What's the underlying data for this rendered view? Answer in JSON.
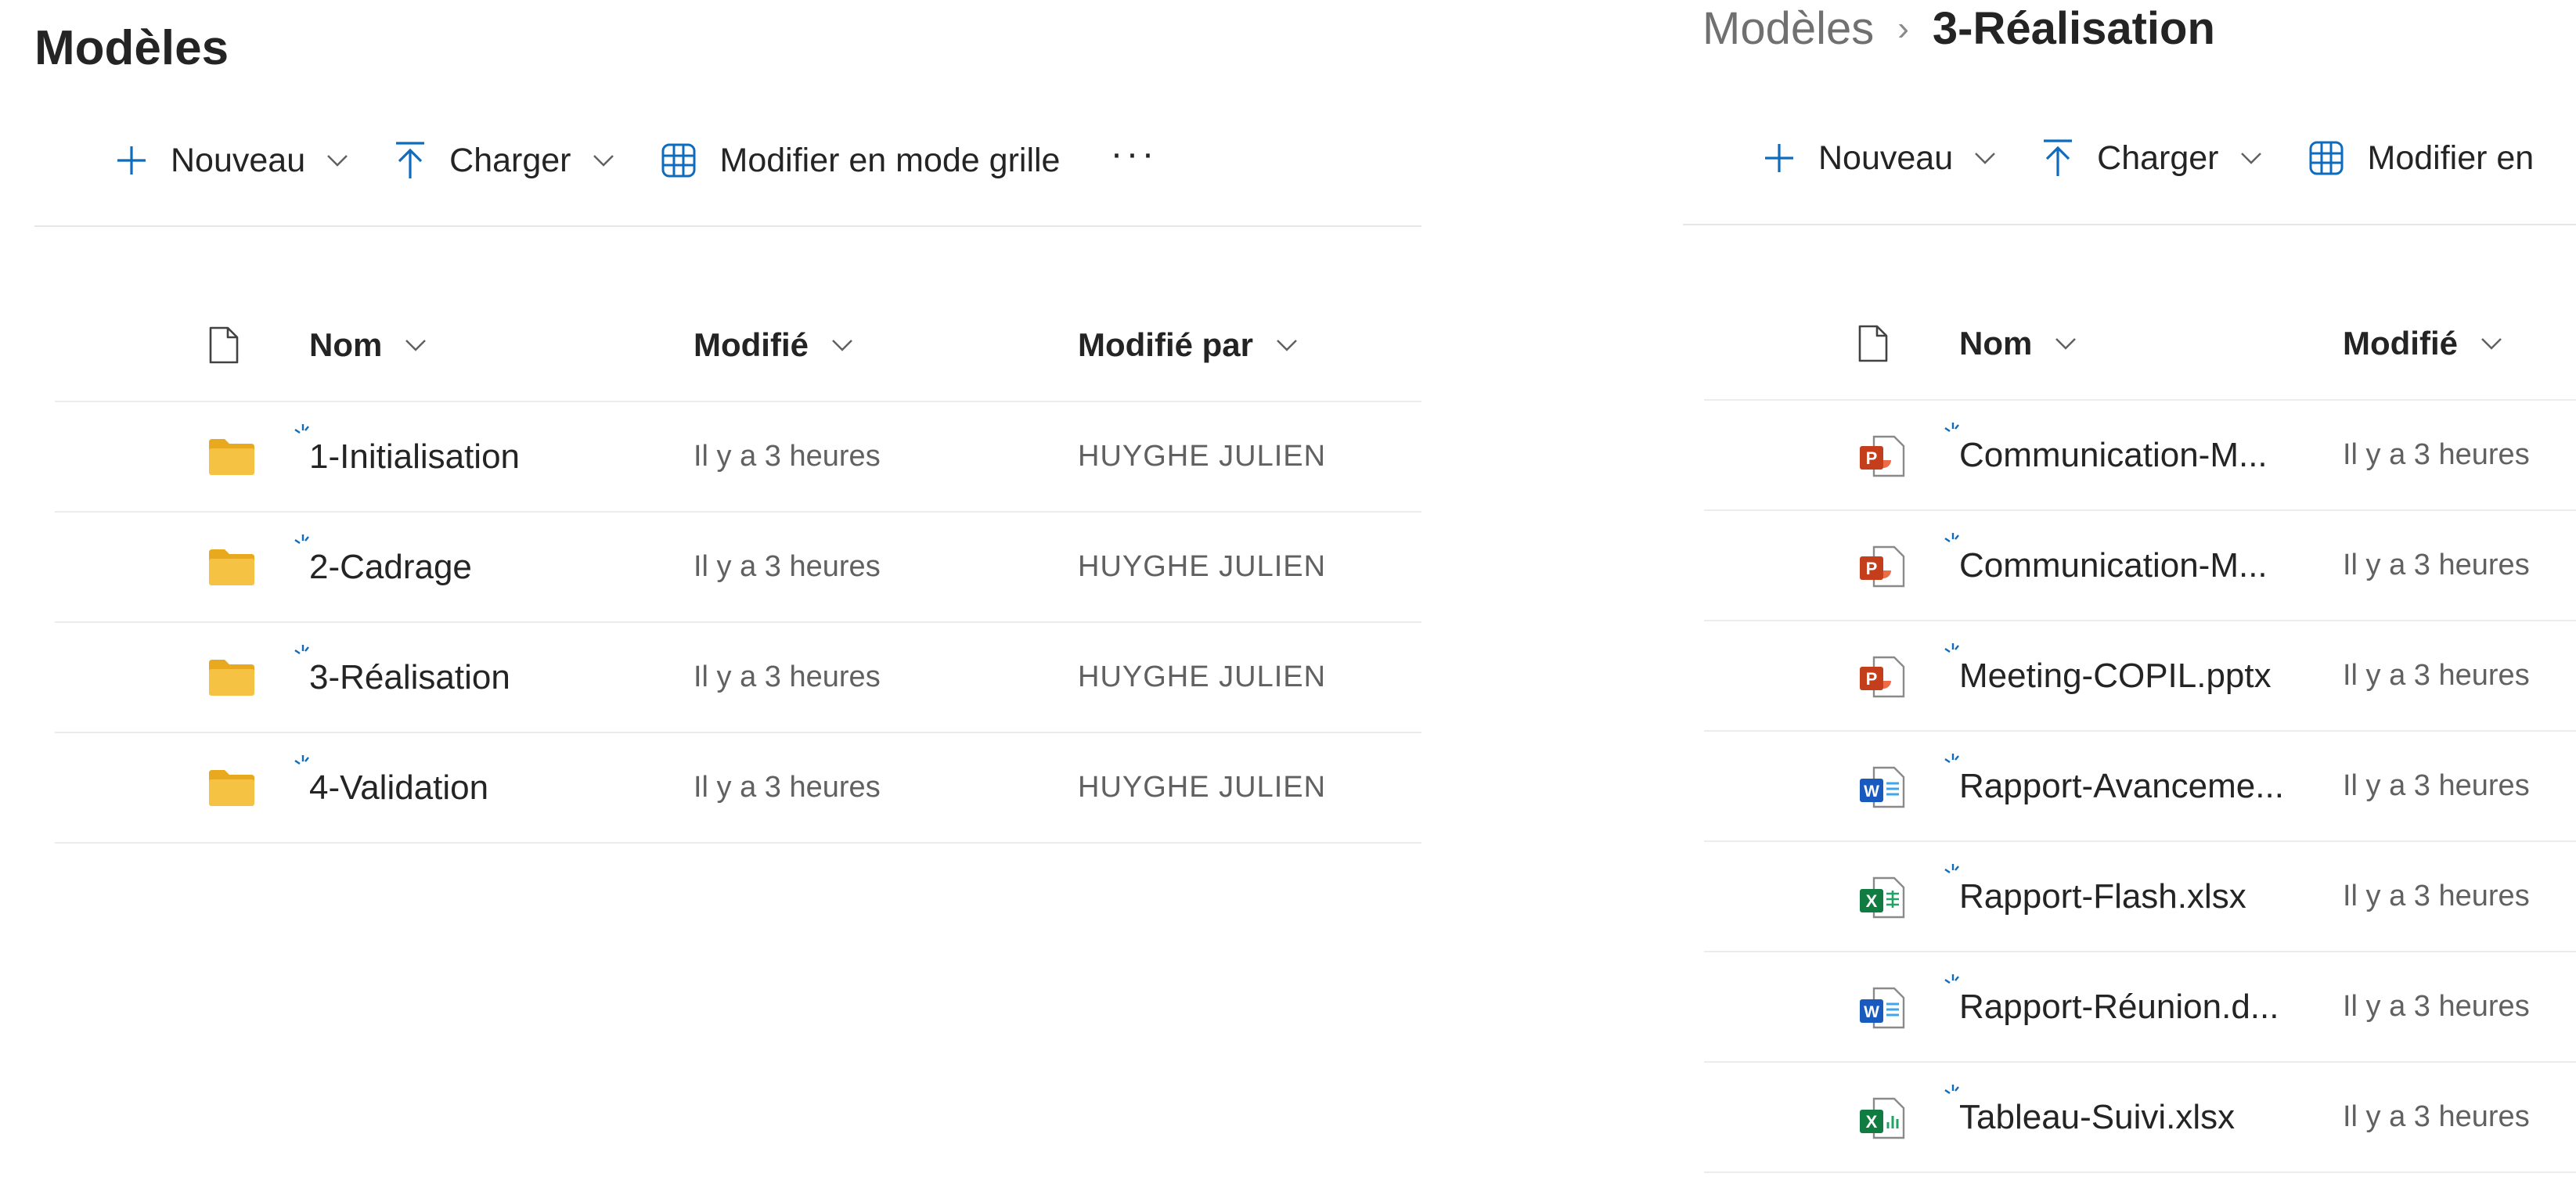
{
  "colors": {
    "accent": "#0f6cbd",
    "folder": "#f6c244",
    "folder_back": "#e8a91f",
    "ppt": "#c43e1c",
    "word": "#185abd",
    "excel": "#107c41",
    "text": "#242424",
    "muted": "#616161"
  },
  "left": {
    "title": "Modèles",
    "toolbar": {
      "new_label": "Nouveau",
      "upload_label": "Charger",
      "grid_label": "Modifier en mode grille",
      "more_label": "···"
    },
    "columns": {
      "name": "Nom",
      "modified": "Modifié",
      "modified_by": "Modifié par"
    },
    "rows": [
      {
        "icon": "folder-icon",
        "name": "1-Initialisation",
        "modified": "Il y a 3 heures",
        "modified_by": "HUYGHE JULIEN"
      },
      {
        "icon": "folder-icon",
        "name": "2-Cadrage",
        "modified": "Il y a 3 heures",
        "modified_by": "HUYGHE JULIEN"
      },
      {
        "icon": "folder-icon",
        "name": "3-Réalisation",
        "modified": "Il y a 3 heures",
        "modified_by": "HUYGHE JULIEN"
      },
      {
        "icon": "folder-icon",
        "name": "4-Validation",
        "modified": "Il y a 3 heures",
        "modified_by": "HUYGHE JULIEN"
      }
    ]
  },
  "right": {
    "breadcrumb": {
      "root": "Modèles",
      "separator": "›",
      "current": "3-Réalisation"
    },
    "toolbar": {
      "new_label": "Nouveau",
      "upload_label": "Charger",
      "grid_label": "Modifier en"
    },
    "columns": {
      "name": "Nom",
      "modified": "Modifié"
    },
    "rows": [
      {
        "icon": "powerpoint-file-icon",
        "name": "Communication-M...",
        "modified": "Il y a 3 heures"
      },
      {
        "icon": "powerpoint-file-icon",
        "name": "Communication-M...",
        "modified": "Il y a 3 heures"
      },
      {
        "icon": "powerpoint-file-icon",
        "name": "Meeting-COPIL.pptx",
        "modified": "Il y a 3 heures"
      },
      {
        "icon": "word-file-icon",
        "name": "Rapport-Avanceme...",
        "modified": "Il y a 3 heures"
      },
      {
        "icon": "excel-file-icon",
        "name": "Rapport-Flash.xlsx",
        "modified": "Il y a 3 heures"
      },
      {
        "icon": "word-file-icon",
        "name": "Rapport-Réunion.d...",
        "modified": "Il y a 3 heures"
      },
      {
        "icon": "excel-file-icon",
        "name": "Tableau-Suivi.xlsx",
        "modified": "Il y a 3 heures"
      }
    ]
  }
}
